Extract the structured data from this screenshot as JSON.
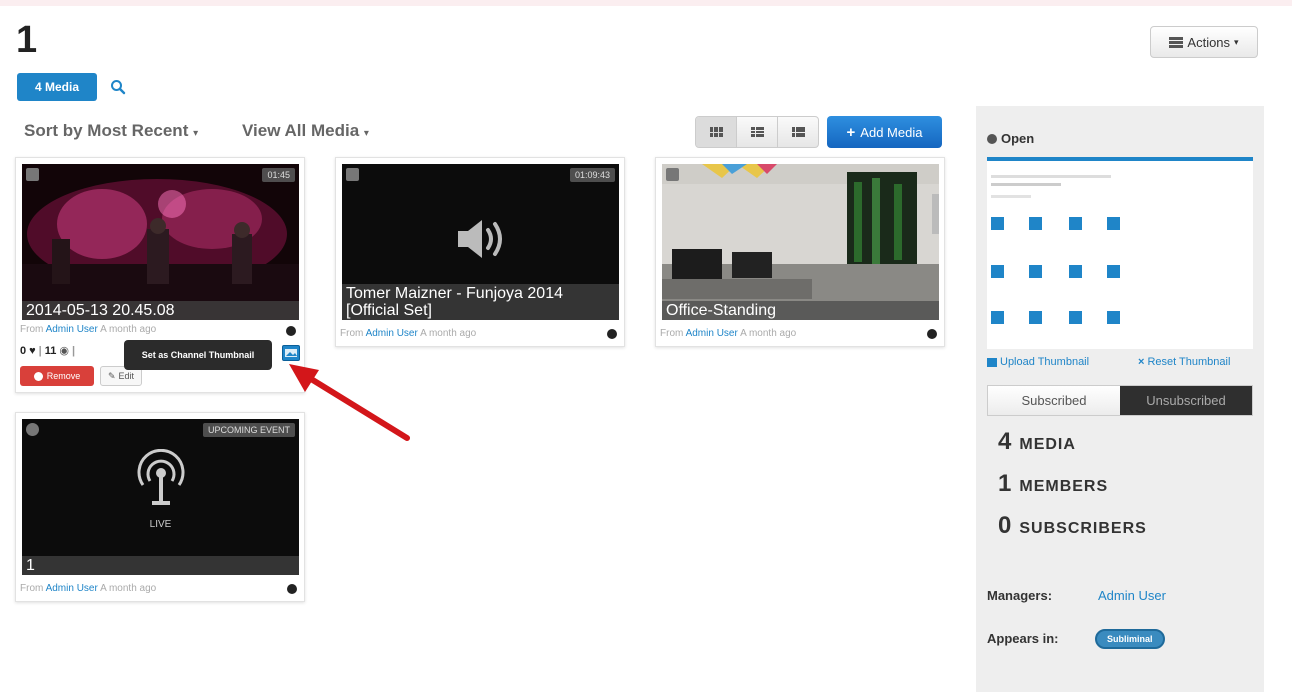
{
  "header": {
    "title": "1",
    "actions_label": "Actions"
  },
  "tabs": {
    "media_label": "4 Media"
  },
  "toolbar": {
    "sort_label": "Sort by Most Recent",
    "view_label": "View All Media",
    "add_media_label": "Add Media"
  },
  "cards": [
    {
      "caption": "2014-05-13 20.45.08",
      "duration": "01:45",
      "from_prefix": "From",
      "author": "Admin User",
      "time": "A month ago"
    },
    {
      "caption": "Tomer Maizner - Funjoya 2014 [Official Set]",
      "duration": "01:09:43",
      "from_prefix": "From",
      "author": "Admin User",
      "time": "A month ago"
    },
    {
      "caption": "Office-Standing",
      "duration": "",
      "from_prefix": "From",
      "author": "Admin User",
      "time": "A month ago"
    },
    {
      "caption": "1",
      "duration": "UPCOMING EVENT",
      "from_prefix": "From",
      "author": "Admin User",
      "time": "A month ago",
      "live_label": "LIVE"
    }
  ],
  "card0_stats": {
    "likes": "0",
    "views": "11"
  },
  "card0_buttons": {
    "remove": "Remove",
    "edit": "Edit"
  },
  "tooltip": "Set as Channel Thumbnail",
  "sidebar": {
    "open_label": "Open",
    "upload_thumbnail": "Upload Thumbnail",
    "reset_thumbnail": "Reset Thumbnail",
    "subscribed": "Subscribed",
    "unsubscribed": "Unsubscribed",
    "stats": [
      {
        "num": "4",
        "label": "MEDIA"
      },
      {
        "num": "1",
        "label": "MEMBERS"
      },
      {
        "num": "0",
        "label": "SUBSCRIBERS"
      }
    ],
    "managers_label": "Managers:",
    "managers_value": "Admin User",
    "appears_label": "Appears in:",
    "appears_value": "Subliminal"
  },
  "colors": {
    "accent": "#1f85c8",
    "danger": "#d9403a",
    "dark": "#2b2b2b"
  }
}
